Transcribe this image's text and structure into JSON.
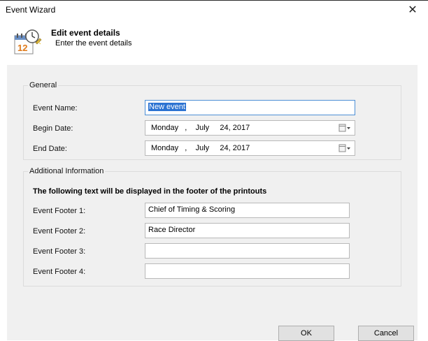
{
  "window": {
    "title": "Event Wizard"
  },
  "header": {
    "title": "Edit event details",
    "subtitle": "Enter the event details",
    "icon": "calendar-clock-wizard-icon"
  },
  "general": {
    "legend": "General",
    "event_name_label": "Event Name:",
    "event_name_value": "New event",
    "begin_date_label": "Begin Date:",
    "begin_date_value": "Monday   ,    July     24, 2017",
    "end_date_label": "End Date:",
    "end_date_value": "Monday   ,    July     24, 2017"
  },
  "additional": {
    "legend": "Additional Information",
    "notice": "The following text will be displayed in the footer of the printouts",
    "footers": [
      {
        "label": "Event Footer 1:",
        "value": "Chief of Timing & Scoring"
      },
      {
        "label": "Event Footer 2:",
        "value": "Race Director"
      },
      {
        "label": "Event Footer 3:",
        "value": ""
      },
      {
        "label": "Event Footer 4:",
        "value": ""
      }
    ]
  },
  "buttons": {
    "ok": "OK",
    "cancel": "Cancel"
  },
  "colors": {
    "selection": "#2c73d2",
    "panel": "#f0f0f0",
    "focus_border": "#4d8fd6"
  }
}
